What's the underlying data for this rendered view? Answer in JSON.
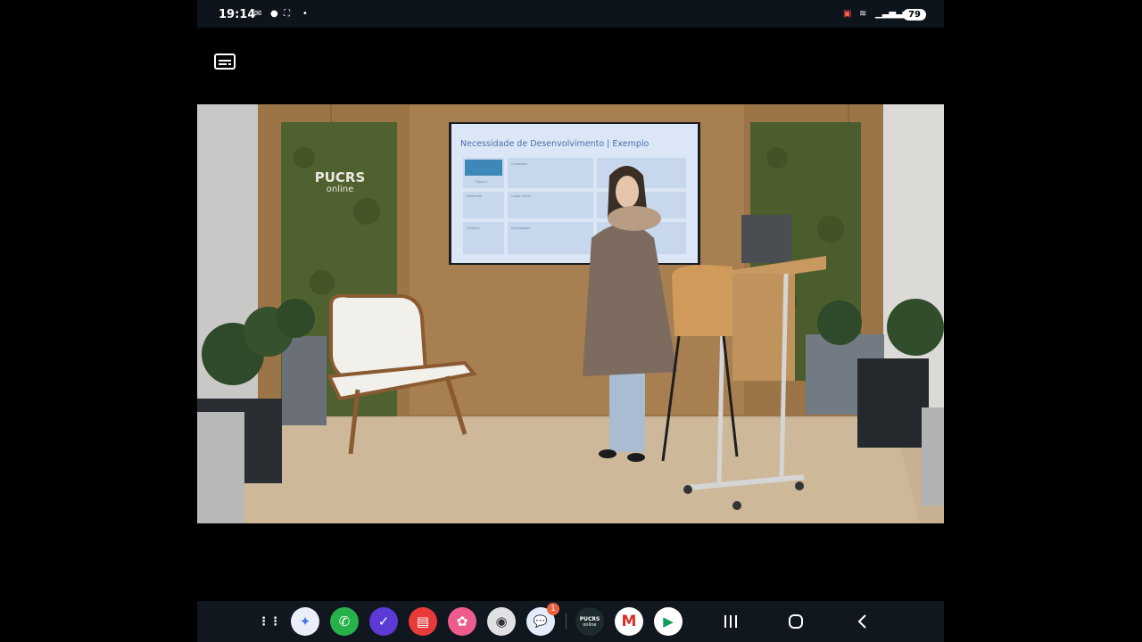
{
  "status_bar": {
    "time": "19:14",
    "battery": "79"
  },
  "video": {
    "slide_title": "Necessidade de Desenvolvimento | Exemplo",
    "slide_cells": [
      "Figura 1",
      "Contextos",
      "Demanda",
      "Cargo Inicial",
      "Objetivo",
      "Metodologia"
    ],
    "wall_logo_line1": "PUCRS",
    "wall_logo_line2": "online"
  },
  "taskbar": {
    "apps": [
      {
        "name": "apps-grid-icon",
        "label": "⋮⋮"
      },
      {
        "name": "gemini-icon",
        "label": "✦"
      },
      {
        "name": "phone-icon",
        "label": "✆"
      },
      {
        "name": "tasks-icon",
        "label": "✓"
      },
      {
        "name": "notes-icon",
        "label": "▤"
      },
      {
        "name": "gallery-icon",
        "label": "✿"
      },
      {
        "name": "camera-icon",
        "label": "◉"
      },
      {
        "name": "messages-icon",
        "label": "💬"
      },
      {
        "name": "pucrs-online-icon",
        "label": "PUCRS"
      },
      {
        "name": "gmail-icon",
        "label": "M"
      },
      {
        "name": "play-store-icon",
        "label": "▶"
      }
    ],
    "messages_badge": "1",
    "pucrs_sub": "online"
  },
  "colors": {
    "status_bar_bg": "#0e141b",
    "taskbar_bg": "#10171f",
    "wood_wall": "#9a7449",
    "moss_panel": "#4d5f2e",
    "slide_bg": "#dbe7f6"
  }
}
